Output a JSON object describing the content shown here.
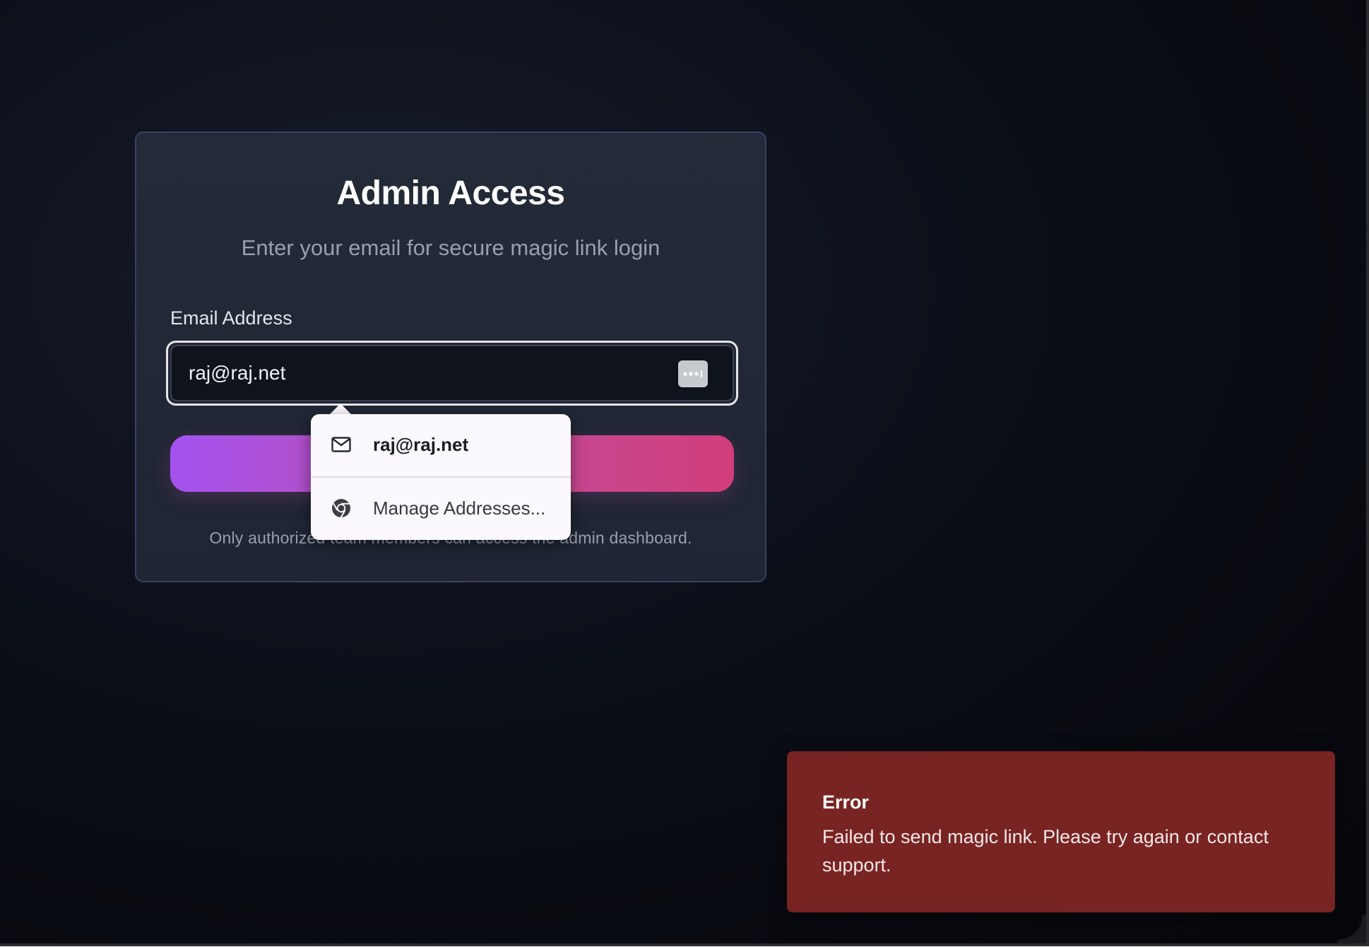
{
  "login_card": {
    "title": "Admin Access",
    "subtitle": "Enter your email for secure magic link login",
    "email_label": "Email Address",
    "email_value": "raj@raj.net",
    "submit_label": "",
    "footer_note": "Only authorized team members can access the admin dashboard."
  },
  "autofill": {
    "items": [
      {
        "label": "raj@raj.net",
        "icon": "mail-icon"
      },
      {
        "label": "Manage Addresses...",
        "icon": "chrome-icon"
      }
    ],
    "password_key_icon": "password-dots-icon"
  },
  "toast": {
    "title": "Error",
    "message": "Failed to send magic link. Please try again or contact support.",
    "background_color": "#782423"
  },
  "colors": {
    "gradient_start": "#a452f0",
    "gradient_end": "#d23e7a",
    "card_border": "#3b3e66"
  }
}
